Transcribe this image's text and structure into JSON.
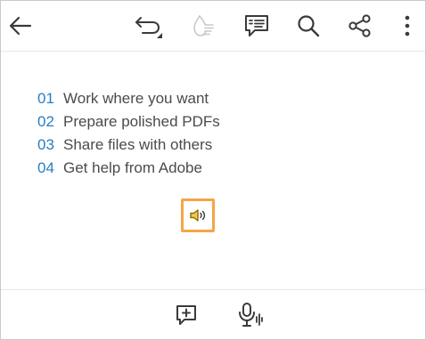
{
  "toolbar": {
    "icons": [
      "back-arrow-icon",
      "undo-icon",
      "liquid-mode-icon",
      "comments-icon",
      "search-icon",
      "share-icon",
      "more-vertical-icon"
    ]
  },
  "toc": {
    "items": [
      {
        "number": "01",
        "label": "Work where you want"
      },
      {
        "number": "02",
        "label": "Prepare polished PDFs"
      },
      {
        "number": "03",
        "label": "Share files with others"
      },
      {
        "number": "04",
        "label": "Get help from Adobe"
      }
    ]
  },
  "read_aloud": {
    "icon": "speaker-icon",
    "highlight_color": "#f5a546"
  },
  "bottom_bar": {
    "icons": [
      "add-comment-icon",
      "voice-input-icon"
    ]
  },
  "colors": {
    "number": "#2680c2",
    "text": "#4b4b4b",
    "icon": "#3a3a3a",
    "disabled_icon": "#c8c8c8",
    "speaker": "#d9a400"
  }
}
